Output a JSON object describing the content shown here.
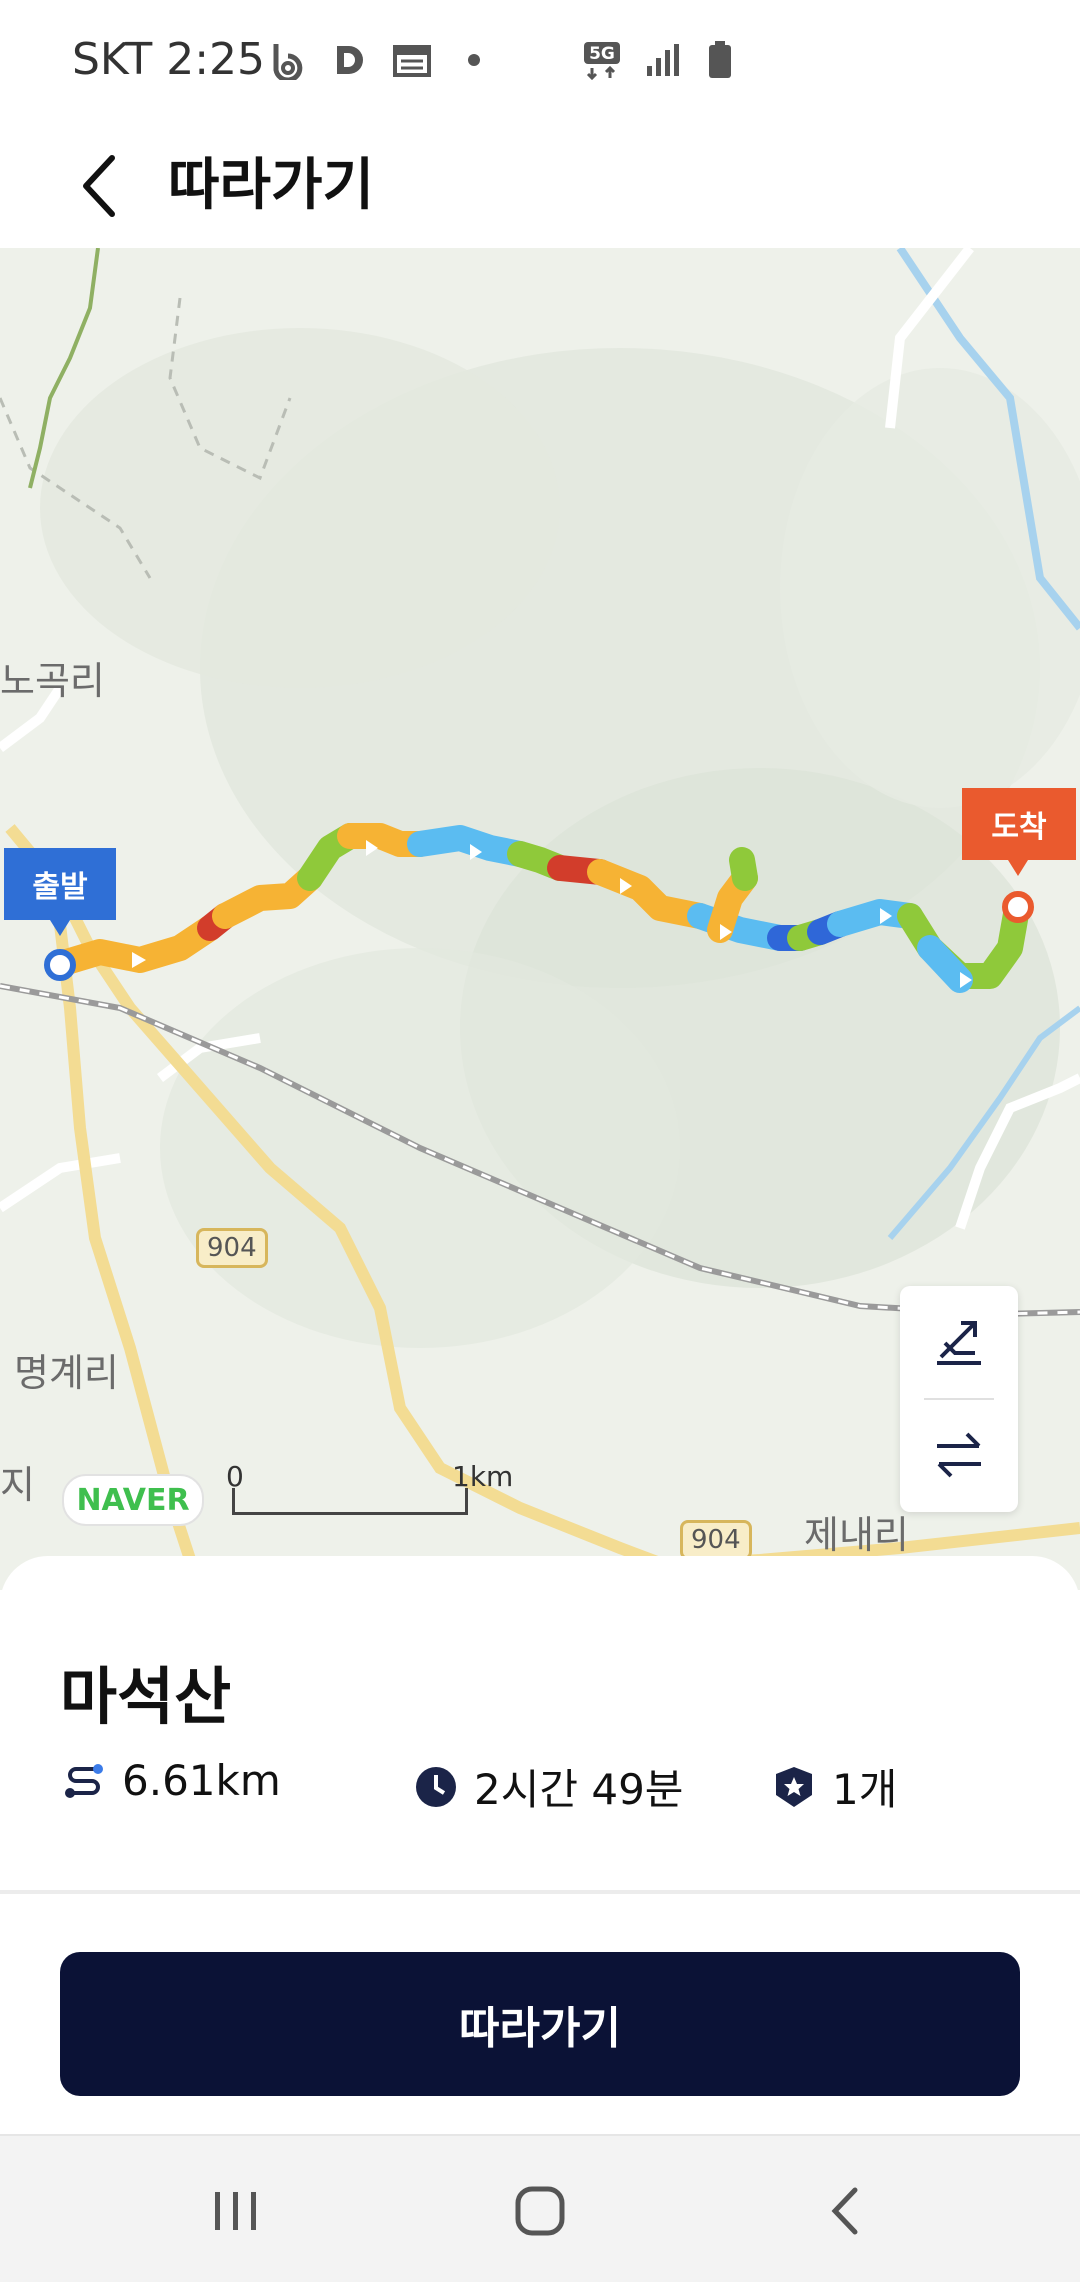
{
  "status_bar": {
    "carrier_time": "SKT 2:25",
    "network": "5G",
    "icons_left": [
      "b-app-icon",
      "d-app-icon",
      "calendar-icon",
      "dot-icon"
    ],
    "icons_right": [
      "5g-icon",
      "signal-icon",
      "battery-icon"
    ]
  },
  "header": {
    "title": "따라가기",
    "back_icon": "chevron-left-icon"
  },
  "map": {
    "places": [
      "노곡리",
      "명계리",
      "제내리",
      "지"
    ],
    "start_label": "출발",
    "end_label": "도착",
    "road_shields": [
      "904",
      "904"
    ],
    "attribution": "NAVER",
    "scale_start": "0",
    "scale_end": "1km",
    "controls": [
      "elevation-toggle-icon",
      "reverse-direction-icon"
    ],
    "route_colors": {
      "easy": "#8fc93a",
      "moderate": "#f6b334",
      "hard": "#d23d2b",
      "downhill": "#5bbcf1",
      "steep-down": "#2f67d8"
    }
  },
  "course": {
    "name": "마석산",
    "distance": "6.61km",
    "duration": "2시간 49분",
    "badge_count": "1개"
  },
  "actions": {
    "follow_button": "따라가기"
  },
  "nav_bar": {
    "buttons": [
      "recent-apps-icon",
      "home-icon",
      "back-icon"
    ]
  }
}
